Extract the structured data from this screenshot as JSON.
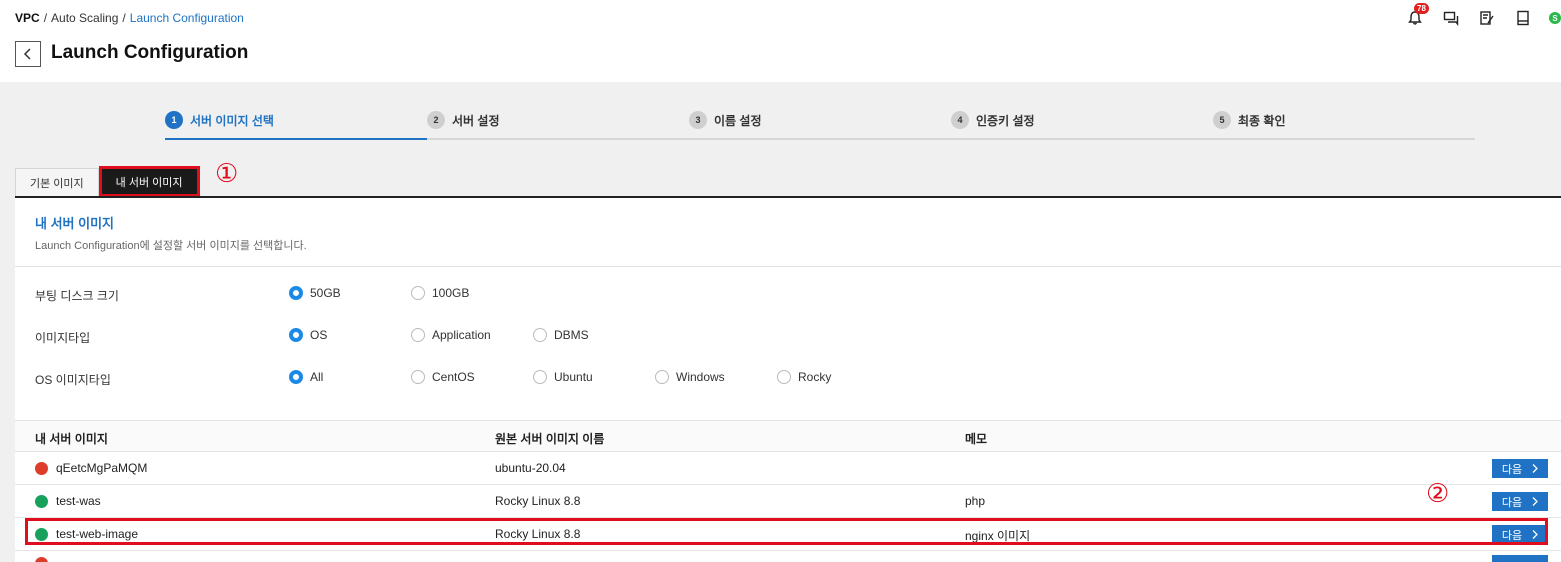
{
  "breadcrumb": {
    "root": "VPC",
    "sep1": "/",
    "mid": "Auto Scaling",
    "sep2": "/",
    "current": "Launch Configuration"
  },
  "page_title": "Launch Configuration",
  "header": {
    "notification_count": "78",
    "user_initial": "S",
    "icons": [
      "bell-icon",
      "chat-icon",
      "edit-icon",
      "book-icon"
    ]
  },
  "steps": [
    {
      "num": "1",
      "label": "서버 이미지 선택",
      "active": true
    },
    {
      "num": "2",
      "label": "서버 설정"
    },
    {
      "num": "3",
      "label": "이름 설정"
    },
    {
      "num": "4",
      "label": "인증키 설정"
    },
    {
      "num": "5",
      "label": "최종 확인"
    }
  ],
  "tabs": [
    {
      "label": "기본 이미지"
    },
    {
      "label": "내 서버 이미지",
      "active": true
    }
  ],
  "annotations": {
    "one": "①",
    "two": "②"
  },
  "panel": {
    "title": "내 서버 이미지",
    "description": "Launch Configuration에 설정할 서버 이미지를 선택합니다."
  },
  "options": [
    {
      "label": "부팅 디스크 크기",
      "choices": [
        "50GB",
        "100GB"
      ],
      "selected": "50GB"
    },
    {
      "label": "이미지타입",
      "choices": [
        "OS",
        "Application",
        "DBMS"
      ],
      "selected": "OS"
    },
    {
      "label": "OS 이미지타입",
      "choices": [
        "All",
        "CentOS",
        "Ubuntu",
        "Windows",
        "Rocky"
      ],
      "selected": "All"
    }
  ],
  "table": {
    "headers": [
      "내 서버 이미지",
      "원본 서버 이미지 이름",
      "메모"
    ],
    "next_label": "다음",
    "rows": [
      {
        "name": "qEetcMgPaMQM",
        "source": "ubuntu-20.04",
        "memo": "",
        "os": "ubuntu"
      },
      {
        "name": "test-was",
        "source": "Rocky Linux 8.8",
        "memo": "php",
        "os": "rocky"
      },
      {
        "name": "test-web-image",
        "source": "Rocky Linux 8.8",
        "memo": "nginx 이미지",
        "os": "rocky"
      }
    ]
  },
  "colors": {
    "accent": "#1f72c4",
    "highlight": "#e00d1c",
    "radio": "#1b8ae6"
  }
}
